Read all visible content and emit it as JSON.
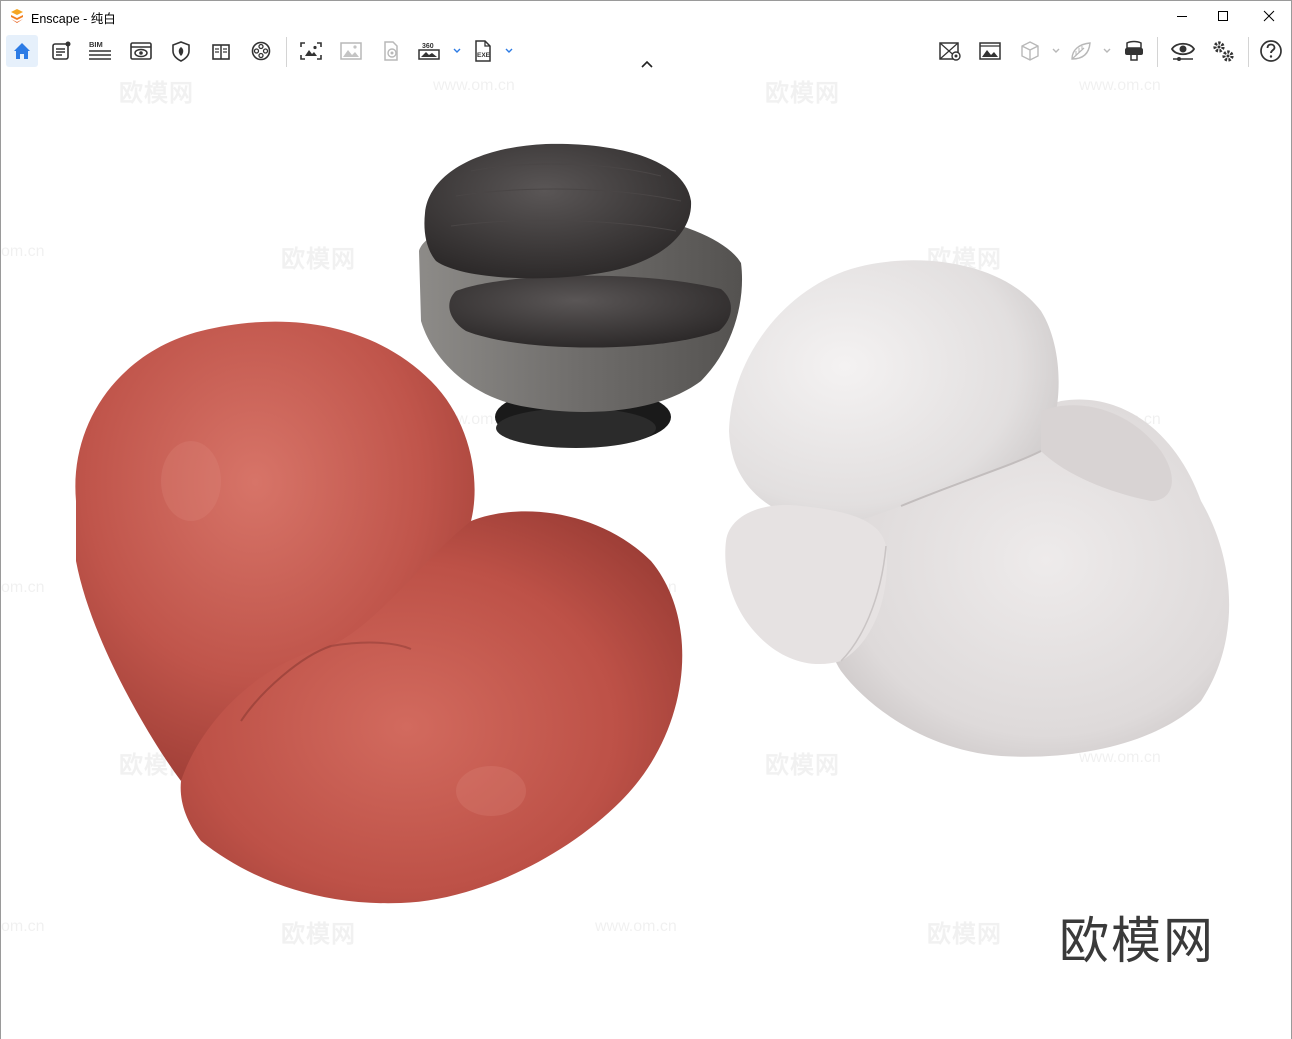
{
  "window": {
    "title": "Enscape - 纯白",
    "controls": [
      "minimize",
      "maximize",
      "close"
    ]
  },
  "toolbar": {
    "left_tools": [
      {
        "name": "home-icon",
        "active": true
      },
      {
        "name": "checklist-icon"
      },
      {
        "name": "bim-icon",
        "label": "BIM"
      },
      {
        "name": "view-window-icon"
      },
      {
        "name": "shield-asset-icon"
      },
      {
        "name": "book-library-icon"
      },
      {
        "name": "video-reel-icon"
      },
      {
        "name": "screenshot-icon"
      },
      {
        "name": "image-icon"
      },
      {
        "name": "panorama-icon"
      },
      {
        "name": "360-export-icon",
        "label": "360"
      },
      {
        "name": "exe-export-icon",
        "label": "EXE"
      }
    ],
    "right_tools": [
      {
        "name": "view-manager-icon"
      },
      {
        "name": "batch-render-icon"
      },
      {
        "name": "cube-icon"
      },
      {
        "name": "leaf-material-icon"
      },
      {
        "name": "vr-headset-icon"
      },
      {
        "name": "eye-settings-icon"
      },
      {
        "name": "gears-icon"
      },
      {
        "name": "help-icon",
        "label": "?"
      }
    ]
  },
  "viewport": {
    "watermark_text": "欧模网",
    "watermark_url": "www.om.cn",
    "partial_url": "om.cn",
    "brand_mark": "欧模网"
  },
  "colors": {
    "accent": "#2c7be5",
    "terracotta_chair": "#c0524a",
    "white_chair": "#e6e2e1",
    "dark_chair": "#3b3838"
  }
}
